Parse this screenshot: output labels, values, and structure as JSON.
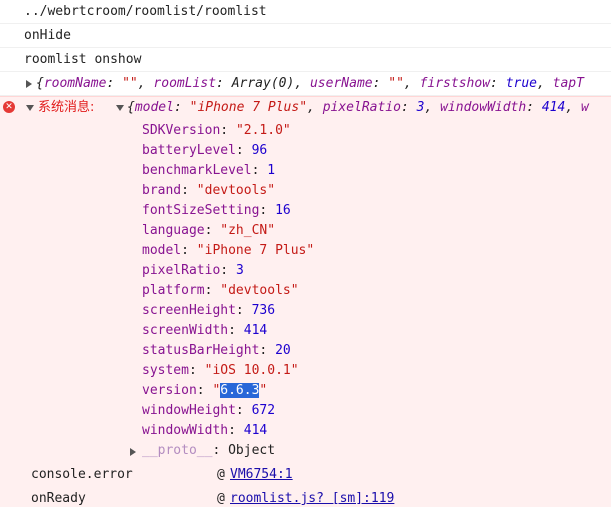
{
  "log": {
    "url_line": "../webrtcroom/roomlist/roomlist",
    "on_hide": "onHide",
    "on_show": "roomlist onshow",
    "state_obj": {
      "open": "{",
      "k1": "roomName",
      "v1": "\"\"",
      "k2": "roomList",
      "v2": "Array(0)",
      "k3": "userName",
      "v3": "\"\"",
      "k4": "firstshow",
      "v4": "true",
      "k5": "tapT"
    }
  },
  "error": {
    "label": "系统消息:",
    "summary": {
      "open": "{",
      "k1": "model",
      "v1": "\"iPhone 7 Plus\"",
      "k2": "pixelRatio",
      "v2": "3",
      "k3": "windowWidth",
      "v3": "414",
      "k4": "w"
    },
    "props": [
      {
        "key": "SDKVersion",
        "value": "\"2.1.0\"",
        "kind": "str"
      },
      {
        "key": "batteryLevel",
        "value": "96",
        "kind": "num"
      },
      {
        "key": "benchmarkLevel",
        "value": "1",
        "kind": "num"
      },
      {
        "key": "brand",
        "value": "\"devtools\"",
        "kind": "str"
      },
      {
        "key": "fontSizeSetting",
        "value": "16",
        "kind": "num"
      },
      {
        "key": "language",
        "value": "\"zh_CN\"",
        "kind": "str"
      },
      {
        "key": "model",
        "value": "\"iPhone 7 Plus\"",
        "kind": "str"
      },
      {
        "key": "pixelRatio",
        "value": "3",
        "kind": "num"
      },
      {
        "key": "platform",
        "value": "\"devtools\"",
        "kind": "str"
      },
      {
        "key": "screenHeight",
        "value": "736",
        "kind": "num"
      },
      {
        "key": "screenWidth",
        "value": "414",
        "kind": "num"
      },
      {
        "key": "statusBarHeight",
        "value": "20",
        "kind": "num"
      },
      {
        "key": "system",
        "value": "\"iOS 10.0.1\"",
        "kind": "str"
      },
      {
        "key": "version",
        "value_pre": "\"",
        "value_sel": "6.6.3",
        "value_post": "\"",
        "kind": "str-sel"
      },
      {
        "key": "windowHeight",
        "value": "672",
        "kind": "num"
      },
      {
        "key": "windowWidth",
        "value": "414",
        "kind": "num"
      }
    ],
    "proto": {
      "key": "__proto__",
      "value": "Object"
    },
    "trace": [
      {
        "name": "console.error",
        "at": "@",
        "link": "VM6754:1"
      },
      {
        "name": "onReady",
        "at": "@",
        "link": "roomlist.js? [sm]:119"
      }
    ]
  },
  "colors": {
    "error_bg": "#fff0f0",
    "error_text": "#e21b1b",
    "key": "#881391",
    "string": "#c41a16",
    "number": "#1c00cf",
    "link": "#1a0dab",
    "selection": "#2867d8"
  }
}
